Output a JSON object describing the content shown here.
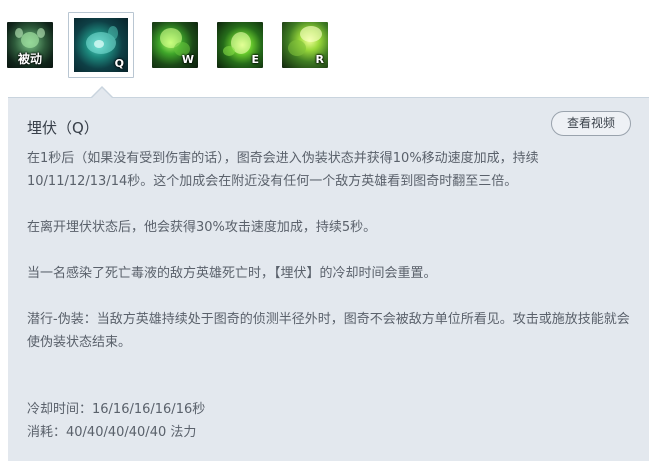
{
  "skills": [
    {
      "key_label": "被动",
      "icon": "passive-skill-icon"
    },
    {
      "key_label": "Q",
      "icon": "ambush-skill-icon",
      "selected": true
    },
    {
      "key_label": "W",
      "icon": "w-skill-icon"
    },
    {
      "key_label": "E",
      "icon": "e-skill-icon"
    },
    {
      "key_label": "R",
      "icon": "r-skill-icon"
    }
  ],
  "detail": {
    "title": "埋伏（Q）",
    "video_button": "查看视频",
    "paragraphs": [
      "在1秒后（如果没有受到伤害的话），图奇会进入伪装状态并获得10%移动速度加成，持续10/11/12/13/14秒。这个加成会在附近没有任何一个敌方英雄看到图奇时翻至三倍。",
      "在离开埋伏状态后，他会获得30%攻击速度加成，持续5秒。",
      "当一名感染了死亡毒液的敌方英雄死亡时，【埋伏】的冷却时间会重置。",
      "潜行-伪装：当敌方英雄持续处于图奇的侦测半径外时，图奇不会被敌方单位所看见。攻击或施放技能就会使伪装状态结束。"
    ],
    "cooldown": "冷却时间：16/16/16/16/16秒",
    "cost": "消耗：40/40/40/40/40 法力"
  },
  "colors": {
    "panel_bg": "#e3e8ee",
    "panel_border": "#c9d4de",
    "text": "#5a616b"
  }
}
